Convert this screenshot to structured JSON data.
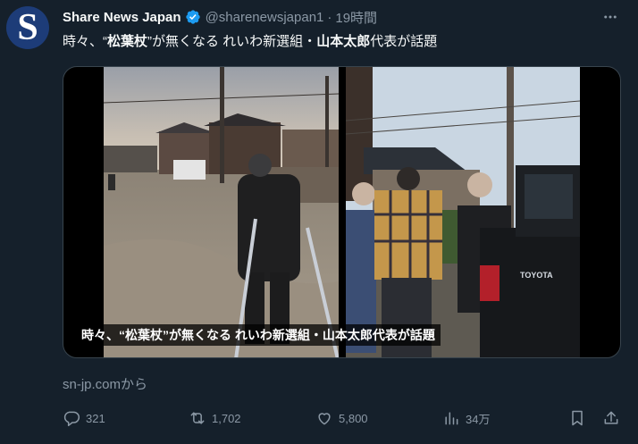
{
  "author": {
    "avatar_letter": "S",
    "name": "Share News Japan",
    "handle": "@sharenewsjapan1",
    "separator": "·",
    "time": "19時間",
    "verified_color": "#1d9bf0",
    "avatar_color": "#1d3c78"
  },
  "tweet": {
    "text_part1": "時々、“",
    "text_bold1": "松葉杖",
    "text_part2": "”が無くなる れいわ新選組・",
    "text_bold2": "山本太郎",
    "text_part3": "代表が話題"
  },
  "media": {
    "caption": "時々、“松葉杖”が無くなる れいわ新選組・山本太郎代表が話題",
    "car_badge": "TOYOTA"
  },
  "source": "sn-jp.comから",
  "actions": {
    "reply_count": "321",
    "retweet_count": "1,702",
    "like_count": "5,800",
    "view_count": "34万"
  },
  "icons": [
    "verified-icon",
    "more-icon",
    "reply-icon",
    "retweet-icon",
    "like-icon",
    "views-icon",
    "bookmark-icon",
    "share-icon"
  ],
  "colors": {
    "background": "#15202b",
    "text": "#f7f9f9",
    "secondary": "#8b98a5"
  }
}
